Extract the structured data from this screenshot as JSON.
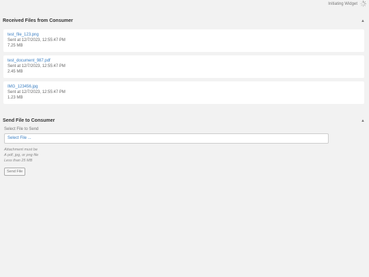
{
  "status": {
    "text": "Initiating Widget",
    "icon": "spinner-icon"
  },
  "received": {
    "title": "Received Files from Consumer",
    "files": [
      {
        "name": "test_file_123.png",
        "sent": "Sent at 12/7/2023, 12:55:47 PM",
        "size": "7.25 MB"
      },
      {
        "name": "test_document_987.pdf",
        "sent": "Sent at 12/7/2023, 12:55:47 PM",
        "size": "2.45 MB"
      },
      {
        "name": "IMG_123456.jpg",
        "sent": "Sent at 12/7/2023, 12:55:47 PM",
        "size": "1.23 MB"
      }
    ]
  },
  "send": {
    "title": "Send File to Consumer",
    "field_label": "Select File to Send",
    "placeholder": "Select File ...",
    "hint": [
      "Attachment must be",
      "A pdf, jpg, or png file",
      "Less than 25 MB"
    ],
    "button_label": "Send File"
  },
  "colors": {
    "link": "#3a7ec2",
    "background": "#f2f2f2",
    "card": "#ffffff"
  }
}
